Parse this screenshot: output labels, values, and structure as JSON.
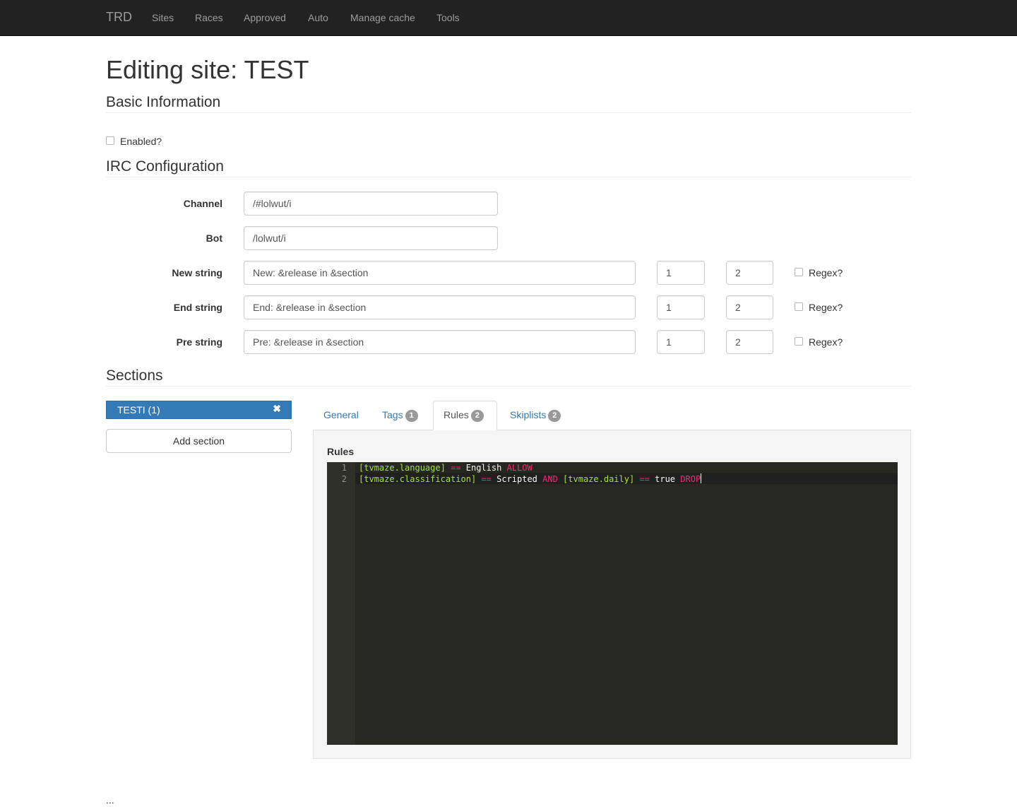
{
  "navbar": {
    "brand": "TRD",
    "items": [
      "Sites",
      "Races",
      "Approved",
      "Auto",
      "Manage cache",
      "Tools"
    ]
  },
  "page_title": "Editing site: TEST",
  "basic": {
    "heading": "Basic Information",
    "enabled_label": "Enabled?",
    "enabled_checked": false
  },
  "irc": {
    "heading": "IRC Configuration",
    "channel": {
      "label": "Channel",
      "value": "/#lolwut/i"
    },
    "bot": {
      "label": "Bot",
      "value": "/lolwut/i"
    },
    "strings": [
      {
        "label": "New string",
        "value": "New: &release in &section",
        "a": "1",
        "b": "2",
        "regex_label": "Regex?",
        "regex_checked": false
      },
      {
        "label": "End string",
        "value": "End: &release in &section",
        "a": "1",
        "b": "2",
        "regex_label": "Regex?",
        "regex_checked": false
      },
      {
        "label": "Pre string",
        "value": "Pre: &release in &section",
        "a": "1",
        "b": "2",
        "regex_label": "Regex?",
        "regex_checked": false
      }
    ]
  },
  "sections": {
    "heading": "Sections",
    "list": [
      {
        "label": "TESTI (1)",
        "close": "✖"
      }
    ],
    "add_button": "Add section",
    "tabs": [
      {
        "label": "General",
        "badge": ""
      },
      {
        "label": "Tags",
        "badge": "1"
      },
      {
        "label": "Rules",
        "badge": "2",
        "active": true
      },
      {
        "label": "Skiplists",
        "badge": "2"
      }
    ],
    "panel_title": "Rules",
    "editor": {
      "line_numbers": [
        "1",
        "2"
      ],
      "lines": [
        {
          "t1": "[tvmaze.language]",
          "t2": "==",
          "t3": "English",
          "t4": "ALLOW"
        },
        {
          "t1": "[tvmaze.classification]",
          "t2": "==",
          "t3": "Scripted",
          "t4": "AND",
          "t5": "[tvmaze.daily]",
          "t6": "==",
          "t7": "true",
          "t8": "DROP"
        }
      ]
    }
  },
  "footer_ellipsis": "...",
  "colors": {
    "navbar_bg": "#222222",
    "nav_text": "#9d9d9d",
    "primary": "#337ab7",
    "badge": "#999999",
    "editor_bg": "#272822",
    "syntax_green": "#a6e22e",
    "syntax_pink": "#f92672"
  }
}
